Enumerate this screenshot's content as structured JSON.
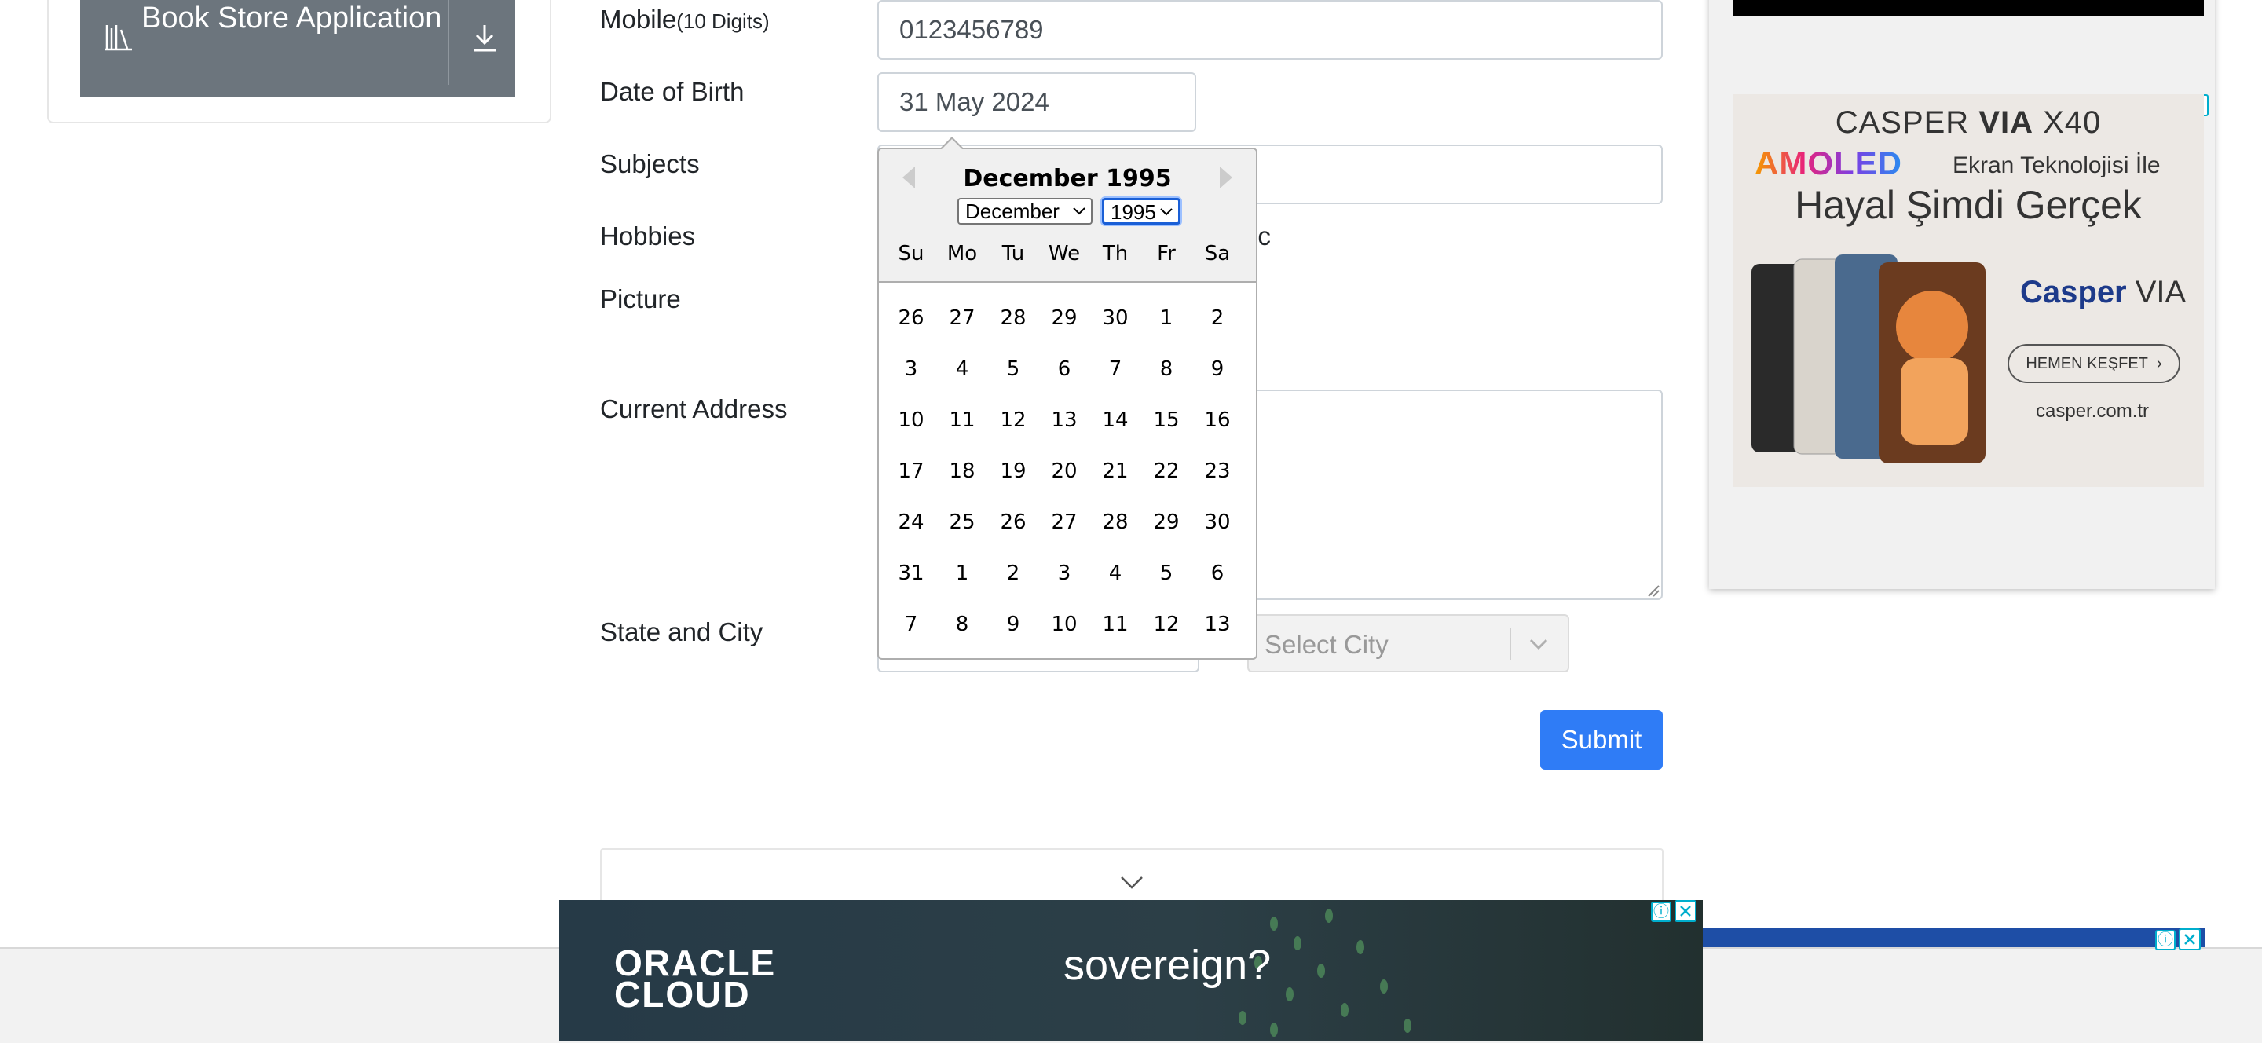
{
  "sidebar": {
    "book_store_label": "Book Store Application",
    "book_icon": "books-icon",
    "download_icon": "download-icon"
  },
  "form": {
    "mobile_label": "Mobile",
    "mobile_hint": "(10 Digits)",
    "mobile_value": "0123456789",
    "dob_label": "Date of Birth",
    "dob_value": "31 May 2024",
    "subjects_label": "Subjects",
    "hobbies_label": "Hobbies",
    "hobbies_partial": "ic",
    "picture_label": "Picture",
    "address_label": "Current Address",
    "state_city_label": "State and City",
    "city_placeholder": "Select City",
    "submit_label": "Submit"
  },
  "datepicker": {
    "title": "December 1995",
    "month_select": "December",
    "year_select": "1995",
    "day_names": [
      "Su",
      "Mo",
      "Tu",
      "We",
      "Th",
      "Fr",
      "Sa"
    ],
    "weeks": [
      [
        "26",
        "27",
        "28",
        "29",
        "30",
        "1",
        "2"
      ],
      [
        "3",
        "4",
        "5",
        "6",
        "7",
        "8",
        "9"
      ],
      [
        "10",
        "11",
        "12",
        "13",
        "14",
        "15",
        "16"
      ],
      [
        "17",
        "18",
        "19",
        "20",
        "21",
        "22",
        "23"
      ],
      [
        "24",
        "25",
        "26",
        "27",
        "28",
        "29",
        "30"
      ],
      [
        "31",
        "1",
        "2",
        "3",
        "4",
        "5",
        "6"
      ],
      [
        "7",
        "8",
        "9",
        "10",
        "11",
        "12",
        "13"
      ]
    ]
  },
  "ads": {
    "right": {
      "line1_a": "CASPER ",
      "line1_b": "VIA",
      "line1_c": " X40",
      "line2": "AMOLED",
      "line2b": "Ekran Teknolojisi İle",
      "line3": "Hayal Şimdi Gerçek",
      "brand_a": "Casper",
      "brand_b": " VIA",
      "cta": "HEMEN KEŞFET",
      "url": "casper.com.tr",
      "info_icon": "ⓘ"
    },
    "bottom": {
      "brand_line1": "ORACLE",
      "brand_line2": "CLOUD",
      "tagline": "sovereign?",
      "info_icon": "ⓘ"
    }
  },
  "colors": {
    "primary": "#2f7cf6",
    "secondary": "#6c757d",
    "oracle_bg": "#2c3f47"
  }
}
